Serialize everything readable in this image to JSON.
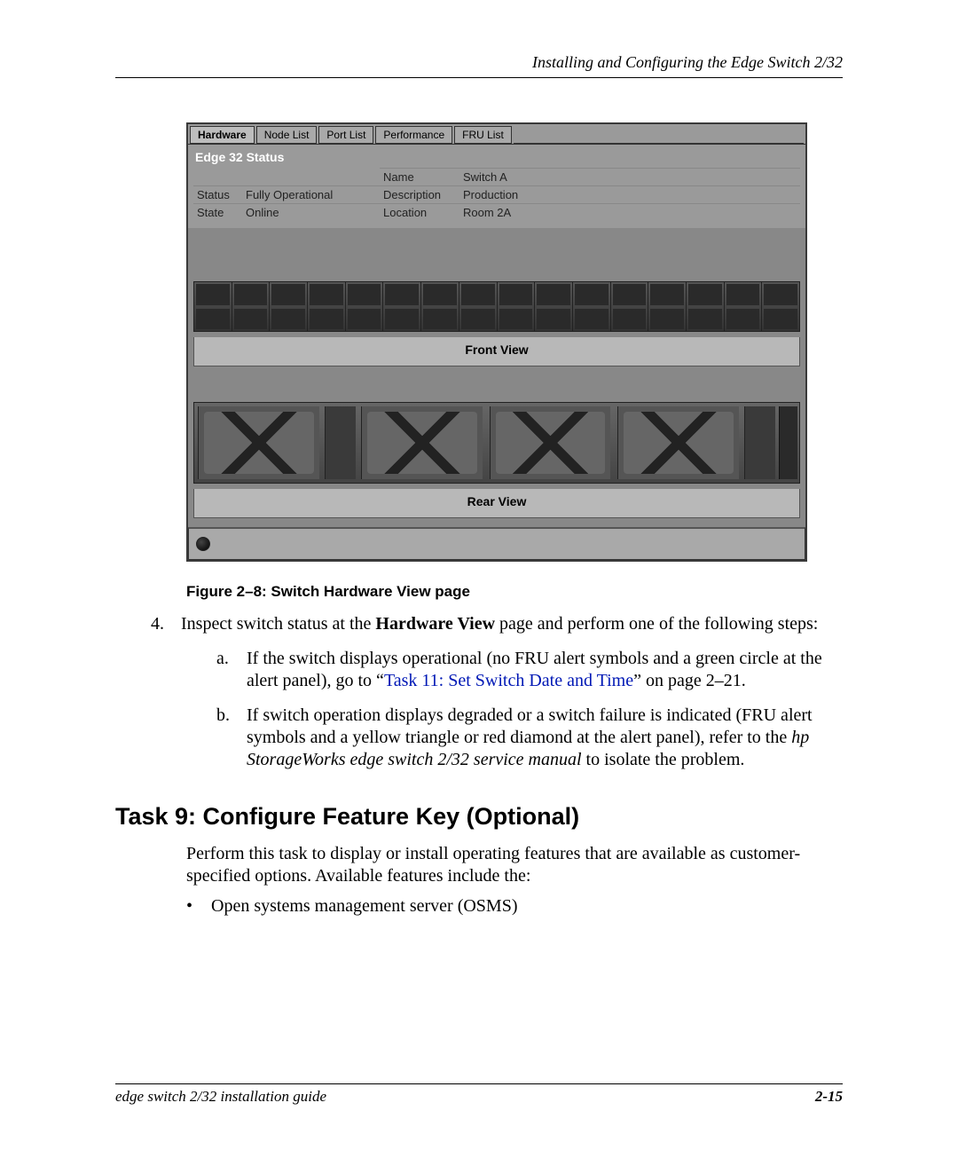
{
  "header": {
    "running": "Installing and Configuring the Edge Switch 2/32"
  },
  "figure": {
    "tabs": [
      "Hardware",
      "Node List",
      "Port List",
      "Performance",
      "FRU List"
    ],
    "status_title": "Edge 32 Status",
    "fields": {
      "status_label": "Status",
      "status_value": "Fully Operational",
      "state_label": "State",
      "state_value": "Online",
      "name_label": "Name",
      "name_value": "Switch A",
      "desc_label": "Description",
      "desc_value": "Production",
      "loc_label": "Location",
      "loc_value": "Room 2A"
    },
    "front_label": "Front View",
    "rear_label": "Rear View",
    "caption": "Figure 2–8:  Switch Hardware View page"
  },
  "step4": {
    "num": "4.",
    "text_a": "Inspect switch status at the ",
    "bold": "Hardware View",
    "text_b": " page and perform one of the following steps:"
  },
  "sub": {
    "a": {
      "letter": "a.",
      "pre": "If the switch displays operational (no FRU alert symbols and a green circle at the alert panel), go to “",
      "link": "Task 11: Set Switch Date and Time",
      "post": "” on page 2–21."
    },
    "b": {
      "letter": "b.",
      "pre": "If switch operation displays degraded or a switch failure is indicated (FRU alert symbols and a yellow triangle or red diamond at the alert panel), refer to the ",
      "ital": "hp StorageWorks edge switch 2/32 service manual",
      "post": " to isolate the problem."
    }
  },
  "task": {
    "heading": "Task 9: Configure Feature Key (Optional)",
    "body": "Perform this task to display or install operating features that are available as customer-specified options. Available features include the:",
    "bullet": "Open systems management server (OSMS)"
  },
  "footer": {
    "left": "edge switch 2/32 installation guide",
    "right": "2-15"
  }
}
